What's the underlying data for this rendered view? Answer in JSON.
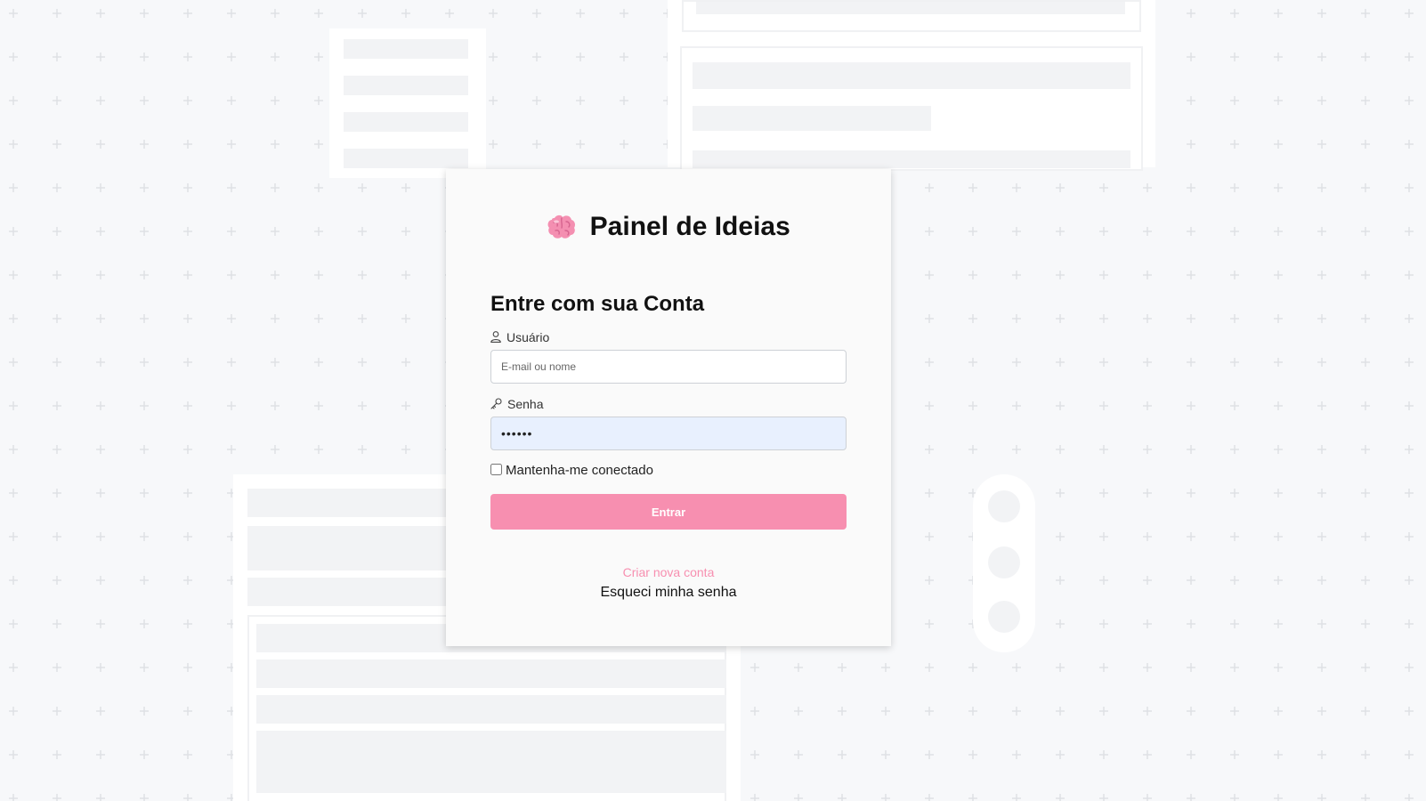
{
  "brand": {
    "icon": "brain-icon",
    "title": "Painel de Ideias"
  },
  "login": {
    "heading": "Entre com sua Conta",
    "username": {
      "icon": "user-icon",
      "label": "Usuário",
      "placeholder": "E-mail ou nome",
      "value": ""
    },
    "password": {
      "icon": "key-icon",
      "label": "Senha",
      "value": "••••••"
    },
    "remember_label": "Mantenha-me conectado",
    "remember_checked": false,
    "submit_label": "Entrar",
    "create_account_label": "Criar nova conta",
    "forgot_password_label": "Esqueci minha senha"
  },
  "colors": {
    "accent": "#f78fb0",
    "background": "#f7f8fa",
    "autofill": "#e8f0fe"
  }
}
